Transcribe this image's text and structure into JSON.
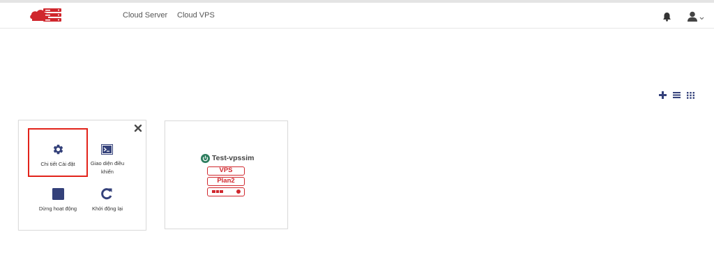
{
  "navbar": {
    "links": [
      {
        "label": "Cloud Server"
      },
      {
        "label": "Cloud VPS"
      }
    ],
    "icons": {
      "bell": "bell-icon",
      "user": "user-icon",
      "logo": "logo"
    }
  },
  "view_controls": [
    {
      "icon": "plus-icon"
    },
    {
      "icon": "list-view-icon"
    },
    {
      "icon": "grid-view-icon"
    }
  ],
  "action_card": {
    "close_icon": "close-icon",
    "actions": [
      {
        "label": "Chi tiết Cài đặt",
        "icon": "gear-icon",
        "selected": true
      },
      {
        "label": "Giao diện điều khiển",
        "icon": "console-icon"
      },
      {
        "label": "Dừng hoạt động",
        "icon": "stop-icon"
      },
      {
        "label": "Khởi động lại",
        "icon": "restart-icon"
      }
    ]
  },
  "server_card": {
    "name": "Test-vpssim",
    "status": "running",
    "badge_lines": [
      "VPS",
      "Plan2"
    ]
  },
  "colors": {
    "brand_red": "#d0272d",
    "icon_navy": "#34417a",
    "status_green": "#2d7d5e",
    "highlight_red": "#e2231a"
  }
}
